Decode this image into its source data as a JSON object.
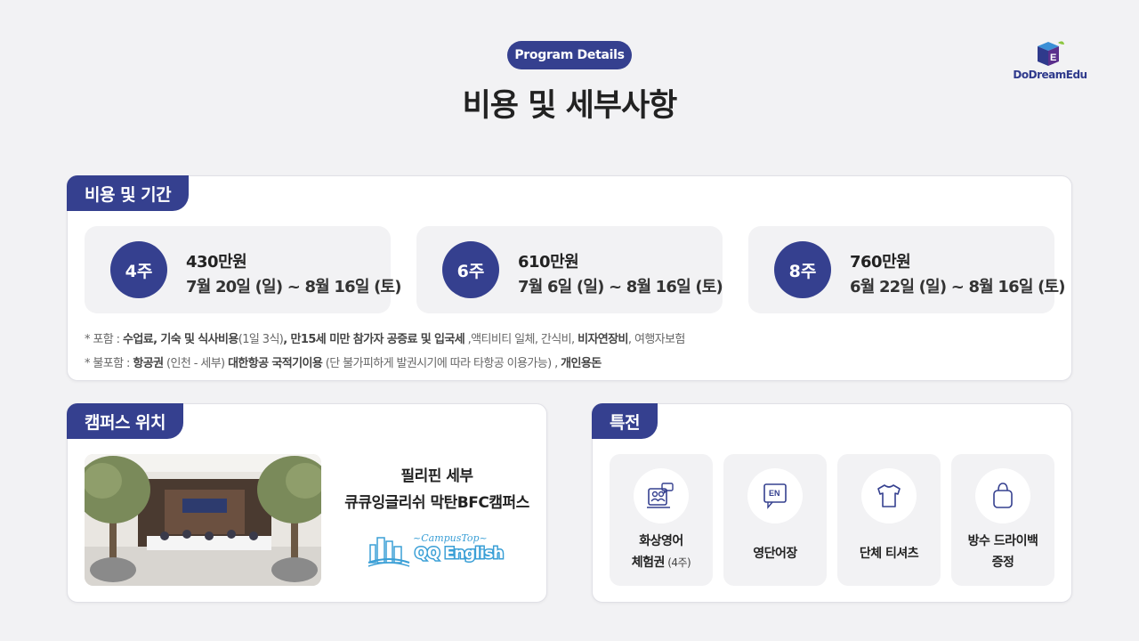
{
  "header": {
    "badge": "Program Details",
    "title": "비용 및 세부사항",
    "logo_text": "DoDreamEdu"
  },
  "cost": {
    "tab": "비용 및 기간",
    "options": [
      {
        "weeks": "4주",
        "price": "430만원",
        "dates": "7월 20일 (일) ~ 8월 16일 (토)"
      },
      {
        "weeks": "6주",
        "price": "610만원",
        "dates": "7월 6일 (일) ~ 8월 16일 (토)"
      },
      {
        "weeks": "8주",
        "price": "760만원",
        "dates": "6월 22일 (일) ~ 8월 16일 (토)"
      }
    ],
    "included": {
      "prefix": "* 포함 : ",
      "tuition": "수업료",
      "comma1": ", ",
      "lodging": "기숙 및 식사비용",
      "meals_note": "(1일 3식)",
      "comma2": ", 만15세 미만 참가자 ",
      "fees": "공증료 및 입국세",
      "comma3": " ,액티비티 일체, 간식비, ",
      "visa": "비자연장비",
      "rest": ", 여행자보험"
    },
    "excluded": {
      "prefix": "* 불포함 : ",
      "airfare": "항공권",
      "route": "  (인천 - 세부)  ",
      "airline": "대한항공 국적기이용",
      "note": " (단 불가피하게 발권시기에 따라 타항공 이용가능) , ",
      "pocket": "개인용돈"
    }
  },
  "campus": {
    "tab": "캠퍼스 위치",
    "line1": "필리핀 세부",
    "line2": "큐큐잉글리쉬 막탄BFC캠퍼스",
    "brand_small": "~CampusTop~",
    "brand_big": "QQ English"
  },
  "perks": {
    "tab": "특전",
    "items": [
      {
        "line1": "화상영어",
        "line2": "체험권",
        "sub": " (4주)",
        "icon": "video-call-icon"
      },
      {
        "line1": "영단어장",
        "icon": "vocabulary-book-icon"
      },
      {
        "line1": "단체 티셔츠",
        "icon": "t-shirt-icon"
      },
      {
        "line1": "방수 드라이백",
        "line2": "증정",
        "icon": "dry-bag-icon"
      }
    ],
    "en_icon_text": "EN"
  },
  "colors": {
    "accent": "#35408f",
    "background": "#f2f2f4",
    "qq_blue": "#3a9fd6"
  }
}
